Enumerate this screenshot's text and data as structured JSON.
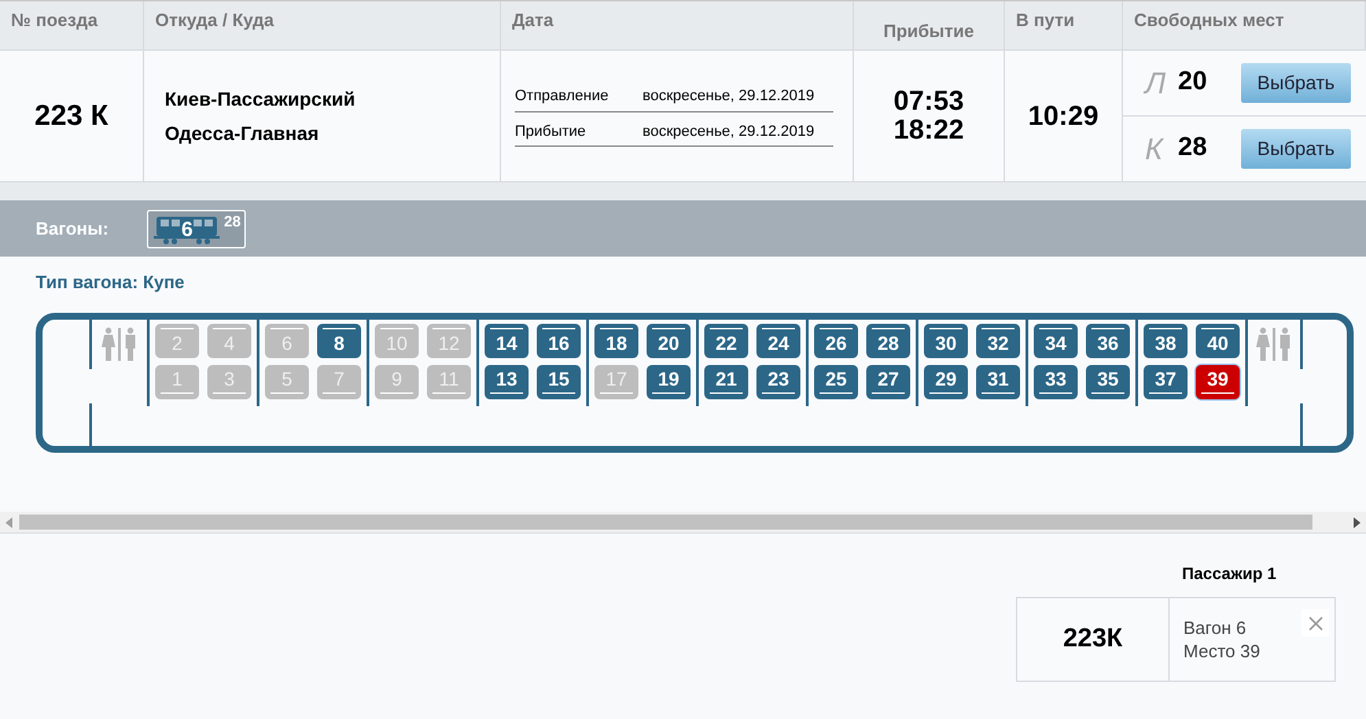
{
  "table": {
    "columns": [
      "№ поезда",
      "Откуда / Куда",
      "Дата",
      "Прибытие",
      "В пути",
      "Свободных мест"
    ],
    "row": {
      "train": "223 К",
      "from": "Киев-Пассажирский",
      "to": "Одесса-Главная",
      "dates": [
        {
          "label": "Отправление",
          "value": "воскресенье, 29.12.2019"
        },
        {
          "label": "Прибытие",
          "value": "воскресенье, 29.12.2019"
        }
      ],
      "departure": "07:53",
      "arrival": "18:22",
      "duration": "10:29",
      "classes": [
        {
          "letter": "Л",
          "count": "20",
          "button": "Выбрать"
        },
        {
          "letter": "К",
          "count": "28",
          "button": "Выбрать"
        }
      ]
    }
  },
  "wagons": {
    "label": "Вагоны:",
    "items": [
      {
        "number": "6",
        "free": "28",
        "selected": true
      }
    ]
  },
  "car": {
    "type_label": "Тип вагона: Купе",
    "compartments": [
      {
        "top": [
          {
            "number": "2",
            "available": false,
            "selected": false
          },
          {
            "number": "4",
            "available": false,
            "selected": false
          }
        ],
        "bottom": [
          {
            "number": "1",
            "available": false,
            "selected": false
          },
          {
            "number": "3",
            "available": false,
            "selected": false
          }
        ]
      },
      {
        "top": [
          {
            "number": "6",
            "available": false,
            "selected": false
          },
          {
            "number": "8",
            "available": true,
            "selected": false
          }
        ],
        "bottom": [
          {
            "number": "5",
            "available": false,
            "selected": false
          },
          {
            "number": "7",
            "available": false,
            "selected": false
          }
        ]
      },
      {
        "top": [
          {
            "number": "10",
            "available": false,
            "selected": false
          },
          {
            "number": "12",
            "available": false,
            "selected": false
          }
        ],
        "bottom": [
          {
            "number": "9",
            "available": false,
            "selected": false
          },
          {
            "number": "11",
            "available": false,
            "selected": false
          }
        ]
      },
      {
        "top": [
          {
            "number": "14",
            "available": true,
            "selected": false
          },
          {
            "number": "16",
            "available": true,
            "selected": false
          }
        ],
        "bottom": [
          {
            "number": "13",
            "available": true,
            "selected": false
          },
          {
            "number": "15",
            "available": true,
            "selected": false
          }
        ]
      },
      {
        "top": [
          {
            "number": "18",
            "available": true,
            "selected": false
          },
          {
            "number": "20",
            "available": true,
            "selected": false
          }
        ],
        "bottom": [
          {
            "number": "17",
            "available": false,
            "selected": false
          },
          {
            "number": "19",
            "available": true,
            "selected": false
          }
        ]
      },
      {
        "top": [
          {
            "number": "22",
            "available": true,
            "selected": false
          },
          {
            "number": "24",
            "available": true,
            "selected": false
          }
        ],
        "bottom": [
          {
            "number": "21",
            "available": true,
            "selected": false
          },
          {
            "number": "23",
            "available": true,
            "selected": false
          }
        ]
      },
      {
        "top": [
          {
            "number": "26",
            "available": true,
            "selected": false
          },
          {
            "number": "28",
            "available": true,
            "selected": false
          }
        ],
        "bottom": [
          {
            "number": "25",
            "available": true,
            "selected": false
          },
          {
            "number": "27",
            "available": true,
            "selected": false
          }
        ]
      },
      {
        "top": [
          {
            "number": "30",
            "available": true,
            "selected": false
          },
          {
            "number": "32",
            "available": true,
            "selected": false
          }
        ],
        "bottom": [
          {
            "number": "29",
            "available": true,
            "selected": false
          },
          {
            "number": "31",
            "available": true,
            "selected": false
          }
        ]
      },
      {
        "top": [
          {
            "number": "34",
            "available": true,
            "selected": false
          },
          {
            "number": "36",
            "available": true,
            "selected": false
          }
        ],
        "bottom": [
          {
            "number": "33",
            "available": true,
            "selected": false
          },
          {
            "number": "35",
            "available": true,
            "selected": false
          }
        ]
      },
      {
        "top": [
          {
            "number": "38",
            "available": true,
            "selected": false
          },
          {
            "number": "40",
            "available": true,
            "selected": false
          }
        ],
        "bottom": [
          {
            "number": "37",
            "available": true,
            "selected": false
          },
          {
            "number": "39",
            "available": true,
            "selected": true
          }
        ]
      }
    ]
  },
  "passengers": [
    {
      "title": "Пассажир 1",
      "train": "223К",
      "wagon": "Вагон 6",
      "seat": "Место 39"
    }
  ]
}
